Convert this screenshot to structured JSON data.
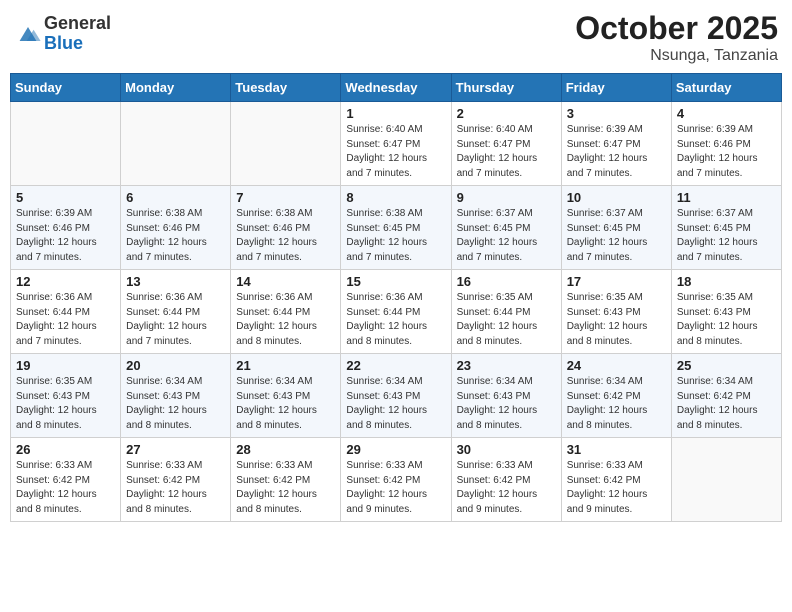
{
  "header": {
    "logo_general": "General",
    "logo_blue": "Blue",
    "month": "October 2025",
    "location": "Nsunga, Tanzania"
  },
  "weekdays": [
    "Sunday",
    "Monday",
    "Tuesday",
    "Wednesday",
    "Thursday",
    "Friday",
    "Saturday"
  ],
  "weeks": [
    [
      {
        "day": "",
        "info": ""
      },
      {
        "day": "",
        "info": ""
      },
      {
        "day": "",
        "info": ""
      },
      {
        "day": "1",
        "info": "Sunrise: 6:40 AM\nSunset: 6:47 PM\nDaylight: 12 hours\nand 7 minutes."
      },
      {
        "day": "2",
        "info": "Sunrise: 6:40 AM\nSunset: 6:47 PM\nDaylight: 12 hours\nand 7 minutes."
      },
      {
        "day": "3",
        "info": "Sunrise: 6:39 AM\nSunset: 6:47 PM\nDaylight: 12 hours\nand 7 minutes."
      },
      {
        "day": "4",
        "info": "Sunrise: 6:39 AM\nSunset: 6:46 PM\nDaylight: 12 hours\nand 7 minutes."
      }
    ],
    [
      {
        "day": "5",
        "info": "Sunrise: 6:39 AM\nSunset: 6:46 PM\nDaylight: 12 hours\nand 7 minutes."
      },
      {
        "day": "6",
        "info": "Sunrise: 6:38 AM\nSunset: 6:46 PM\nDaylight: 12 hours\nand 7 minutes."
      },
      {
        "day": "7",
        "info": "Sunrise: 6:38 AM\nSunset: 6:46 PM\nDaylight: 12 hours\nand 7 minutes."
      },
      {
        "day": "8",
        "info": "Sunrise: 6:38 AM\nSunset: 6:45 PM\nDaylight: 12 hours\nand 7 minutes."
      },
      {
        "day": "9",
        "info": "Sunrise: 6:37 AM\nSunset: 6:45 PM\nDaylight: 12 hours\nand 7 minutes."
      },
      {
        "day": "10",
        "info": "Sunrise: 6:37 AM\nSunset: 6:45 PM\nDaylight: 12 hours\nand 7 minutes."
      },
      {
        "day": "11",
        "info": "Sunrise: 6:37 AM\nSunset: 6:45 PM\nDaylight: 12 hours\nand 7 minutes."
      }
    ],
    [
      {
        "day": "12",
        "info": "Sunrise: 6:36 AM\nSunset: 6:44 PM\nDaylight: 12 hours\nand 7 minutes."
      },
      {
        "day": "13",
        "info": "Sunrise: 6:36 AM\nSunset: 6:44 PM\nDaylight: 12 hours\nand 7 minutes."
      },
      {
        "day": "14",
        "info": "Sunrise: 6:36 AM\nSunset: 6:44 PM\nDaylight: 12 hours\nand 8 minutes."
      },
      {
        "day": "15",
        "info": "Sunrise: 6:36 AM\nSunset: 6:44 PM\nDaylight: 12 hours\nand 8 minutes."
      },
      {
        "day": "16",
        "info": "Sunrise: 6:35 AM\nSunset: 6:44 PM\nDaylight: 12 hours\nand 8 minutes."
      },
      {
        "day": "17",
        "info": "Sunrise: 6:35 AM\nSunset: 6:43 PM\nDaylight: 12 hours\nand 8 minutes."
      },
      {
        "day": "18",
        "info": "Sunrise: 6:35 AM\nSunset: 6:43 PM\nDaylight: 12 hours\nand 8 minutes."
      }
    ],
    [
      {
        "day": "19",
        "info": "Sunrise: 6:35 AM\nSunset: 6:43 PM\nDaylight: 12 hours\nand 8 minutes."
      },
      {
        "day": "20",
        "info": "Sunrise: 6:34 AM\nSunset: 6:43 PM\nDaylight: 12 hours\nand 8 minutes."
      },
      {
        "day": "21",
        "info": "Sunrise: 6:34 AM\nSunset: 6:43 PM\nDaylight: 12 hours\nand 8 minutes."
      },
      {
        "day": "22",
        "info": "Sunrise: 6:34 AM\nSunset: 6:43 PM\nDaylight: 12 hours\nand 8 minutes."
      },
      {
        "day": "23",
        "info": "Sunrise: 6:34 AM\nSunset: 6:43 PM\nDaylight: 12 hours\nand 8 minutes."
      },
      {
        "day": "24",
        "info": "Sunrise: 6:34 AM\nSunset: 6:42 PM\nDaylight: 12 hours\nand 8 minutes."
      },
      {
        "day": "25",
        "info": "Sunrise: 6:34 AM\nSunset: 6:42 PM\nDaylight: 12 hours\nand 8 minutes."
      }
    ],
    [
      {
        "day": "26",
        "info": "Sunrise: 6:33 AM\nSunset: 6:42 PM\nDaylight: 12 hours\nand 8 minutes."
      },
      {
        "day": "27",
        "info": "Sunrise: 6:33 AM\nSunset: 6:42 PM\nDaylight: 12 hours\nand 8 minutes."
      },
      {
        "day": "28",
        "info": "Sunrise: 6:33 AM\nSunset: 6:42 PM\nDaylight: 12 hours\nand 8 minutes."
      },
      {
        "day": "29",
        "info": "Sunrise: 6:33 AM\nSunset: 6:42 PM\nDaylight: 12 hours\nand 9 minutes."
      },
      {
        "day": "30",
        "info": "Sunrise: 6:33 AM\nSunset: 6:42 PM\nDaylight: 12 hours\nand 9 minutes."
      },
      {
        "day": "31",
        "info": "Sunrise: 6:33 AM\nSunset: 6:42 PM\nDaylight: 12 hours\nand 9 minutes."
      },
      {
        "day": "",
        "info": ""
      }
    ]
  ]
}
